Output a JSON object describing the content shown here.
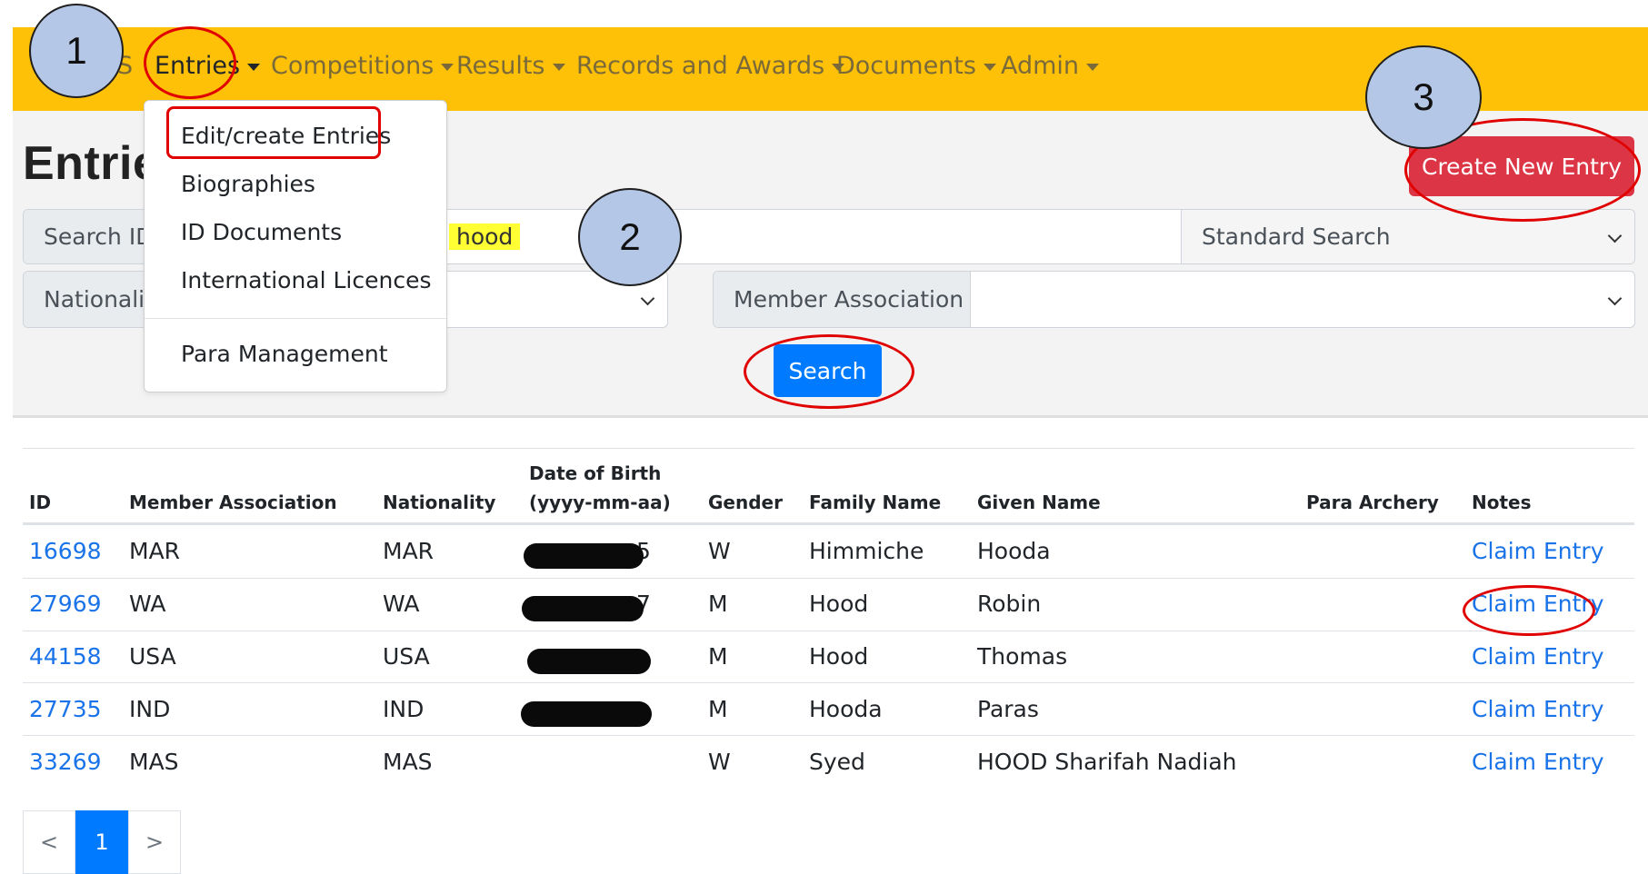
{
  "navbar": {
    "items": [
      {
        "label": "S"
      },
      {
        "label": "Entries"
      },
      {
        "label": "Competitions"
      },
      {
        "label": "Results"
      },
      {
        "label": "Records and Awards"
      },
      {
        "label": "Documents"
      },
      {
        "label": "Admin"
      }
    ]
  },
  "dropdown": {
    "items": [
      {
        "label": "Edit/create Entries"
      },
      {
        "label": "Biographies"
      },
      {
        "label": "ID Documents"
      },
      {
        "label": "International Licences"
      },
      {
        "label": "Para Management"
      }
    ]
  },
  "page": {
    "title": "Entrie"
  },
  "actions": {
    "create_label": "Create New Entry",
    "search_label": "Search"
  },
  "search": {
    "id_label": "Search ID,",
    "query_value": "hood",
    "mode_value": "Standard Search",
    "nationality_label": "Nationalit",
    "member_association_label": "Member Association"
  },
  "table": {
    "headers": {
      "id": "ID",
      "member_association": "Member Association",
      "nationality": "Nationality",
      "dob_line1": "Date of Birth",
      "dob_line2": "(yyyy-mm-aa)",
      "gender": "Gender",
      "family_name": "Family Name",
      "given_name": "Given Name",
      "para_archery": "Para Archery",
      "notes": "Notes"
    },
    "rows": [
      {
        "id": "16698",
        "member_association": "MAR",
        "nationality": "MAR",
        "dob_visible": "5",
        "gender": "W",
        "family_name": "Himmiche",
        "given_name": "Hooda",
        "notes": "Claim Entry"
      },
      {
        "id": "27969",
        "member_association": "WA",
        "nationality": "WA",
        "dob_visible": "7",
        "gender": "M",
        "family_name": "Hood",
        "given_name": "Robin",
        "notes": "Claim Entry"
      },
      {
        "id": "44158",
        "member_association": "USA",
        "nationality": "USA",
        "dob_visible": "",
        "gender": "M",
        "family_name": "Hood",
        "given_name": "Thomas",
        "notes": "Claim Entry"
      },
      {
        "id": "27735",
        "member_association": "IND",
        "nationality": "IND",
        "dob_visible": "",
        "gender": "M",
        "family_name": "Hooda",
        "given_name": "Paras",
        "notes": "Claim Entry"
      },
      {
        "id": "33269",
        "member_association": "MAS",
        "nationality": "MAS",
        "dob_visible": "",
        "gender": "W",
        "family_name": "Syed",
        "given_name": "HOOD Sharifah Nadiah",
        "notes": "Claim Entry"
      }
    ]
  },
  "pagination": {
    "prev": "<",
    "current": "1",
    "next": ">"
  },
  "annotations": {
    "step1": "1",
    "step2": "2",
    "step3": "3"
  },
  "colors": {
    "navbar": "#ffc107",
    "danger": "#dc3545",
    "primary": "#007bff",
    "link": "#1a73e8",
    "annotation_fill": "#b4c7e7",
    "annotation_ring": "#e00000"
  }
}
